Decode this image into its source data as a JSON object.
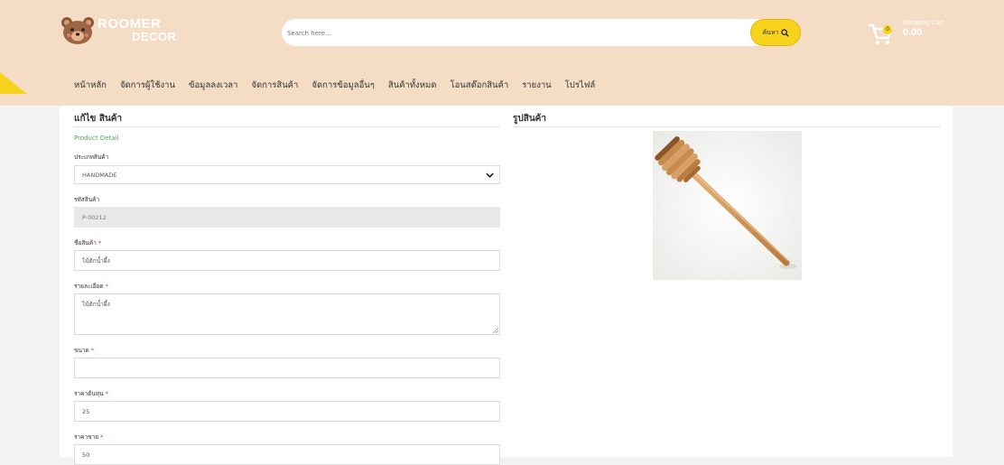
{
  "brand": {
    "line1": "ROOMER",
    "line2": "DECOR"
  },
  "search": {
    "placeholder": "Search here...",
    "button_label": "ค้นหา"
  },
  "cart": {
    "label": "Shopping Cart",
    "amount": "0.00",
    "count": "0"
  },
  "nav": [
    "หน้าหลัก",
    "จัดการผู้ใช้งาน",
    "ข้อมูลลงเวลา",
    "จัดการสินค้า",
    "จัดการข้อมูลอื่นๆ",
    "สินค้าทั้งหมด",
    "โอนสต๊อกสินค้า",
    "รายงาน",
    "โปรไฟล์"
  ],
  "form": {
    "title": "แก้ไข สินค้า",
    "subtitle": "Product Detail",
    "category_label": "ประเภทสินค้า",
    "category_value": "HANDMADE",
    "code_label": "รหัสสินค้า",
    "code_value": "P-00212",
    "name_label": "ชื่อสินค้า",
    "name_value": "ไม้ตักน้ำผึ้ง",
    "detail_label": "รายละเอียด",
    "detail_value": "ไม้ตักน้ำผึ้ง",
    "size_label": "ขนาด",
    "size_value": "",
    "cost_label": "ราคาต้นทุน",
    "cost_value": "25",
    "price_label": "ราคาขาย",
    "price_value": "50",
    "required_mark": "*"
  },
  "image_section": {
    "title": "รูปสินค้า",
    "image": "honey-dipper"
  },
  "colors": {
    "header": "#f5dcc4",
    "accent": "#f7d21d",
    "subtitle": "#4caf50",
    "required": "#e53935"
  }
}
